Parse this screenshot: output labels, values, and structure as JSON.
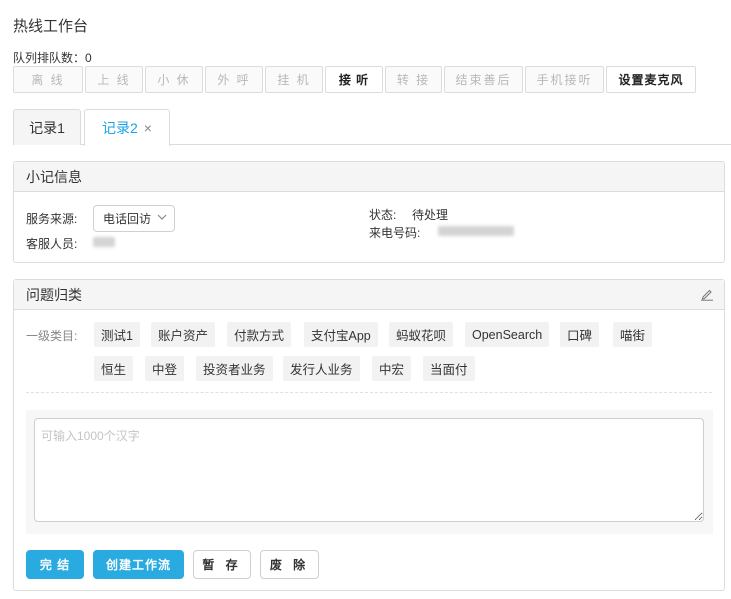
{
  "page": {
    "title": "热线工作台"
  },
  "queue": {
    "text": "队列排队数：0"
  },
  "toolbar": {
    "buttons": [
      {
        "label": "离 线",
        "active": false
      },
      {
        "label": "上 线",
        "active": false
      },
      {
        "label": "小 休",
        "active": false
      },
      {
        "label": "外 呼",
        "active": false
      },
      {
        "label": "挂 机",
        "active": false
      },
      {
        "label": "接 听",
        "active": true
      },
      {
        "label": "转 接",
        "active": false
      },
      {
        "label": "结束善后",
        "active": false
      },
      {
        "label": "手机接听",
        "active": false
      },
      {
        "label": "设置麦克风",
        "active": true
      }
    ]
  },
  "tabs": [
    {
      "label": "记录1",
      "active": false
    },
    {
      "label": "记录2",
      "active": true,
      "close": "×"
    }
  ],
  "info": {
    "header": "小记信息",
    "service_source_label": "服务来源:",
    "service_source_value": "电话回访",
    "agent_label": "客服人员:",
    "status_label": "状态:",
    "status_value": "待处理",
    "caller_label": "来电号码:"
  },
  "classification": {
    "header": "问题归类",
    "level1_label": "一级类目:",
    "tags": [
      "测试1",
      "账户资产",
      "付款方式",
      "支付宝App",
      "蚂蚁花呗",
      "OpenSearch",
      "口碑",
      "喵街",
      "恒生",
      "中登",
      "投资者业务",
      "发行人业务",
      "中宏",
      "当面付"
    ],
    "textarea_placeholder": "可输入1000个汉字"
  },
  "actions": {
    "finish": "完 结",
    "create_workflow": "创建工作流",
    "save_draft": "暂 存",
    "discard": "废 除"
  },
  "colors": {
    "accent": "#29abe2",
    "tab_active": "#1aa3e8"
  },
  "icons": {
    "edit": "pencil-icon",
    "select": "chevron-down-icon",
    "tab_close": "close-icon"
  }
}
